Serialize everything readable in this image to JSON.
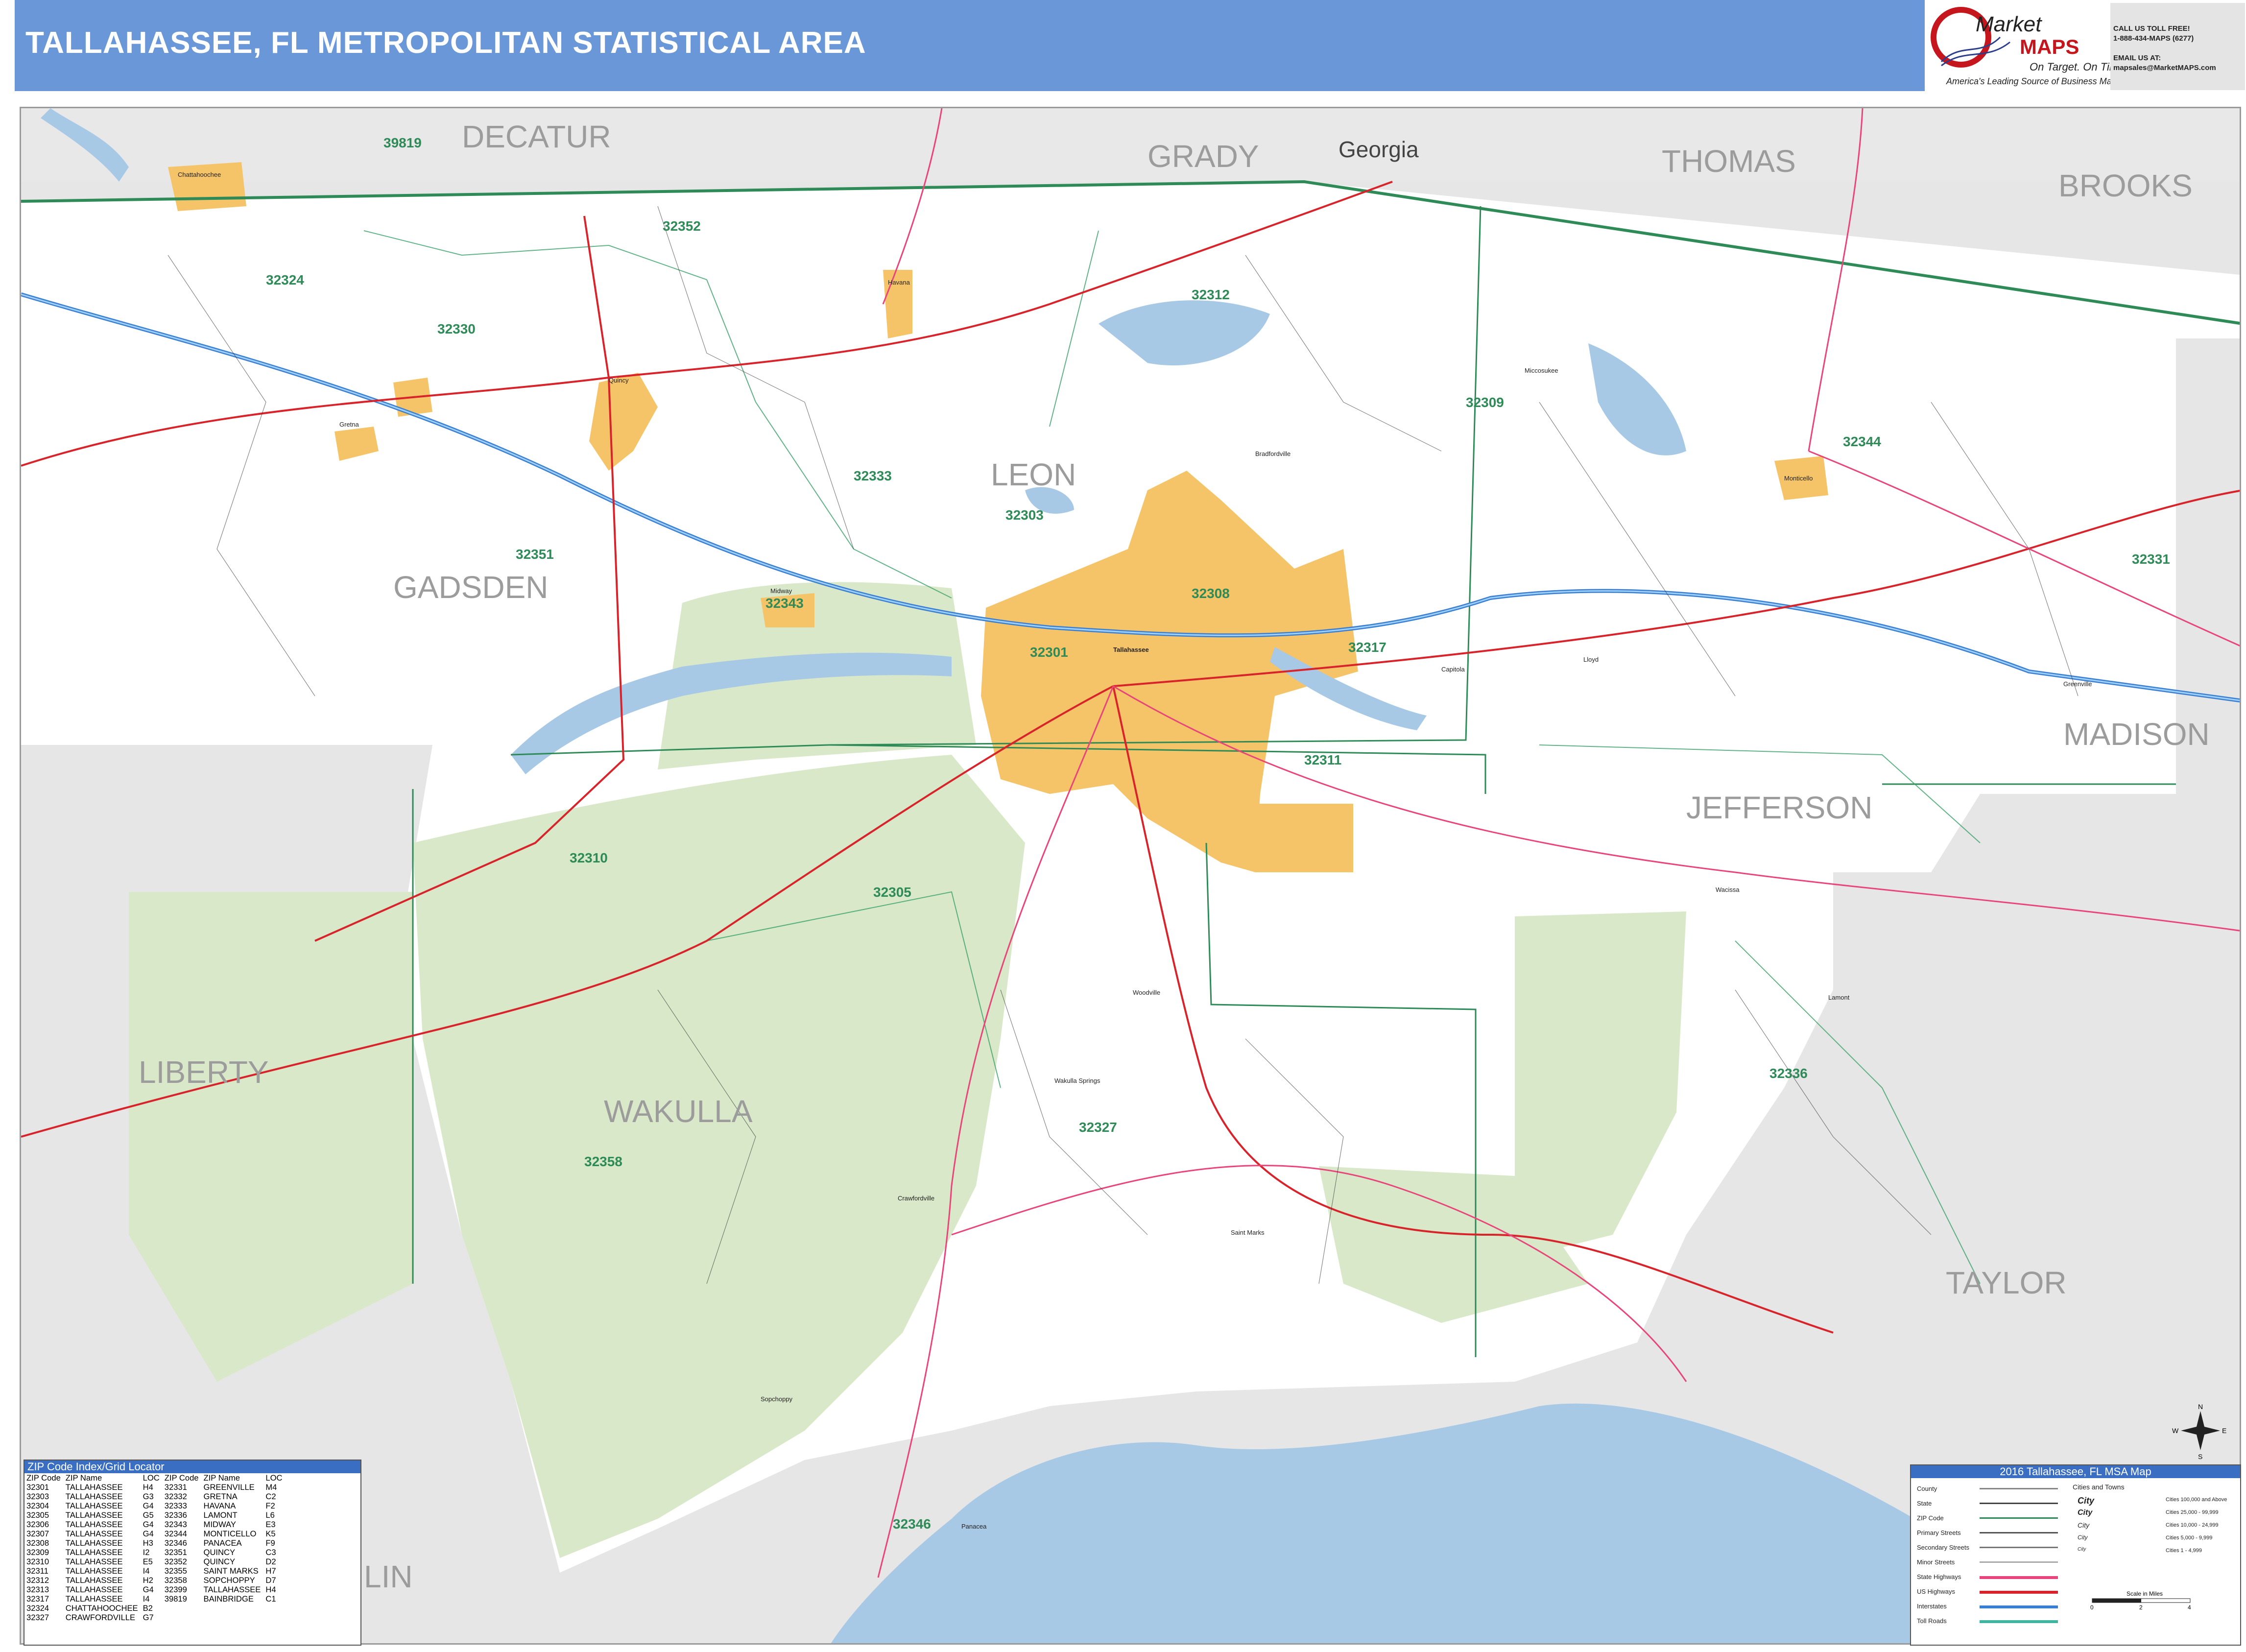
{
  "header": {
    "title": "TALLAHASSEE, FL METROPOLITAN STATISTICAL AREA",
    "bg_color": "#6a97d7"
  },
  "logo": {
    "brand_top": "Market",
    "brand_bottom": "MAPS",
    "slogan": "On Target. On Time.",
    "tagline": "America's Leading Source of Business Maps",
    "icon": "market-maps-logo"
  },
  "contact": {
    "line1": "CALL US TOLL FREE!",
    "line2": "1-888-434-MAPS (6277)",
    "line3": "EMAIL US AT:",
    "line4": "mapsales@MarketMAPS.com"
  },
  "map": {
    "state_label": "Georgia",
    "counties": {
      "decatur": "DECATUR",
      "grady": "GRADY",
      "thomas": "THOMAS",
      "brooks": "BROOKS",
      "gadsden": "GADSDEN",
      "leon": "LEON",
      "madison": "MADISON",
      "jefferson": "JEFFERSON",
      "liberty": "LIBERTY",
      "wakulla": "WAKULLA",
      "taylor": "TAYLOR",
      "franklin_partial": "LIN"
    },
    "zips": [
      "39819",
      "32352",
      "32324",
      "32330",
      "32312",
      "32333",
      "32309",
      "32303",
      "32344",
      "32351",
      "32343",
      "32308",
      "32317",
      "32301",
      "32311",
      "32310",
      "32305",
      "32331",
      "32336",
      "32327",
      "32358",
      "32346"
    ],
    "towns": [
      "Chattahoochee",
      "Gretna",
      "Quincy",
      "Havana",
      "Midway",
      "Tallahassee",
      "Monticello",
      "Woodville",
      "Crawfordville",
      "Panacea",
      "Saint Marks",
      "Sopchoppy",
      "Wakulla Springs",
      "Lamont",
      "Wacissa",
      "Greenville",
      "Lloyd",
      "Miccosukee",
      "Bradfordville",
      "Capitola"
    ],
    "colors": {
      "water": "#a7c9e6",
      "forest": "#d8e8c8",
      "urban": "#f6c468",
      "county_line": "#2e8b57",
      "state_hwy": "#e8457a",
      "us_hwy": "#d8232a",
      "interstate": "#3a7fd1",
      "outside_area": "#e6e6e6"
    },
    "compass": {
      "n": "N",
      "s": "S",
      "e": "E",
      "w": "W"
    }
  },
  "zip_index": {
    "title": "ZIP Code Index/Grid Locator",
    "headers": [
      "ZIP Code",
      "ZIP Name",
      "LOC",
      "ZIP Code",
      "ZIP Name",
      "LOC"
    ],
    "rows": [
      [
        "32301",
        "TALLAHASSEE",
        "H4",
        "32331",
        "GREENVILLE",
        "M4"
      ],
      [
        "32303",
        "TALLAHASSEE",
        "G3",
        "32332",
        "GRETNA",
        "C2"
      ],
      [
        "32304",
        "TALLAHASSEE",
        "G4",
        "32333",
        "HAVANA",
        "F2"
      ],
      [
        "32305",
        "TALLAHASSEE",
        "G5",
        "32336",
        "LAMONT",
        "L6"
      ],
      [
        "32306",
        "TALLAHASSEE",
        "G4",
        "32343",
        "MIDWAY",
        "E3"
      ],
      [
        "32307",
        "TALLAHASSEE",
        "G4",
        "32344",
        "MONTICELLO",
        "K5"
      ],
      [
        "32308",
        "TALLAHASSEE",
        "H3",
        "32346",
        "PANACEA",
        "F9"
      ],
      [
        "32309",
        "TALLAHASSEE",
        "I2",
        "32351",
        "QUINCY",
        "C3"
      ],
      [
        "32310",
        "TALLAHASSEE",
        "E5",
        "32352",
        "QUINCY",
        "D2"
      ],
      [
        "32311",
        "TALLAHASSEE",
        "I4",
        "32355",
        "SAINT MARKS",
        "H7"
      ],
      [
        "32312",
        "TALLAHASSEE",
        "H2",
        "32358",
        "SOPCHOPPY",
        "D7"
      ],
      [
        "32313",
        "TALLAHASSEE",
        "G4",
        "32399",
        "TALLAHASSEE",
        "H4"
      ],
      [
        "32317",
        "TALLAHASSEE",
        "I4",
        "39819",
        "BAINBRIDGE",
        "C1"
      ],
      [
        "32324",
        "CHATTAHOOCHEE",
        "B2",
        "",
        "",
        ""
      ],
      [
        "32327",
        "CRAWFORDVILLE",
        "G7",
        "",
        "",
        ""
      ]
    ]
  },
  "legend": {
    "title": "2016 Tallahassee, FL MSA Map",
    "items": [
      "County",
      "State",
      "ZIP Code",
      "Primary Streets",
      "Secondary Streets",
      "Minor Streets",
      "State Highways",
      "US Highways",
      "Interstates",
      "Toll Roads"
    ],
    "cities_title": "Cities and Towns",
    "city_sizes": [
      "Cities 100,000 and Above",
      "Cities 25,000 - 99,999",
      "Cities 10,000 - 24,999",
      "Cities 5,000 - 9,999",
      "Cities 1 - 4,999"
    ],
    "city_word": "City",
    "scale_title": "Scale in Miles",
    "scale_ticks": [
      "0",
      "2",
      "4"
    ]
  }
}
